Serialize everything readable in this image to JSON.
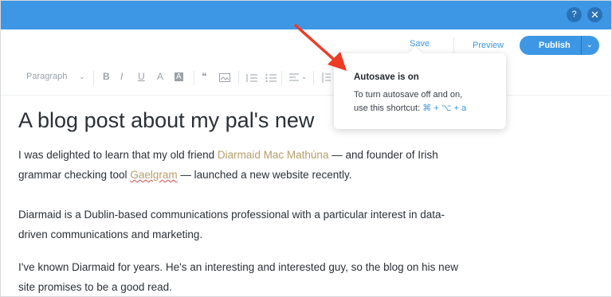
{
  "window": {
    "help_label": "?",
    "close_label": "✕"
  },
  "header": {
    "save_label": "Save",
    "preview_label": "Preview",
    "publish_label": "Publish",
    "publish_caret": "⌄"
  },
  "toolbar": {
    "paragraph_style": "Paragraph",
    "caret": "⌄",
    "bold": "B",
    "italic": "I",
    "underline": "U",
    "text_color": "A",
    "highlight": "A",
    "quote": "❝",
    "align_caret": "⌄"
  },
  "post": {
    "title": "A blog post about my pal's new",
    "p1_line1_pre": "I was delighted to learn that my old friend ",
    "p1_link": "Diarmaid Mac Mathúna",
    "p1_line1_post": " — and founder of Irish",
    "p1_line2_pre": "grammar checking tool ",
    "p1_gaelgram": "Gaelgram",
    "p1_line2_post": " —  launched a new website recently.",
    "p2_line1": "Diarmaid is a Dublin-based communications professional with a particular interest in data-",
    "p2_line2": "driven communications and marketing.",
    "p3_line1": "I've known Diarmaid for years. He's an interesting and interested guy, so the blog on his new",
    "p3_line2": "site promises to be a good read."
  },
  "popover": {
    "title": "Autosave is on",
    "body_line1": "To turn autosave off and on,",
    "body_line2_pre": "use this shortcut: ",
    "shortcut": "⌘ + ⌥ + a"
  },
  "colors": {
    "accent": "#3d97e5",
    "link": "#b79e6a",
    "arrow": "#ee3b23"
  },
  "icons": [
    "help-icon",
    "close-icon",
    "chevron-down-icon",
    "quote-icon",
    "image-icon",
    "numbered-list-icon",
    "bullet-list-icon",
    "align-icon",
    "line-spacing-icon"
  ]
}
